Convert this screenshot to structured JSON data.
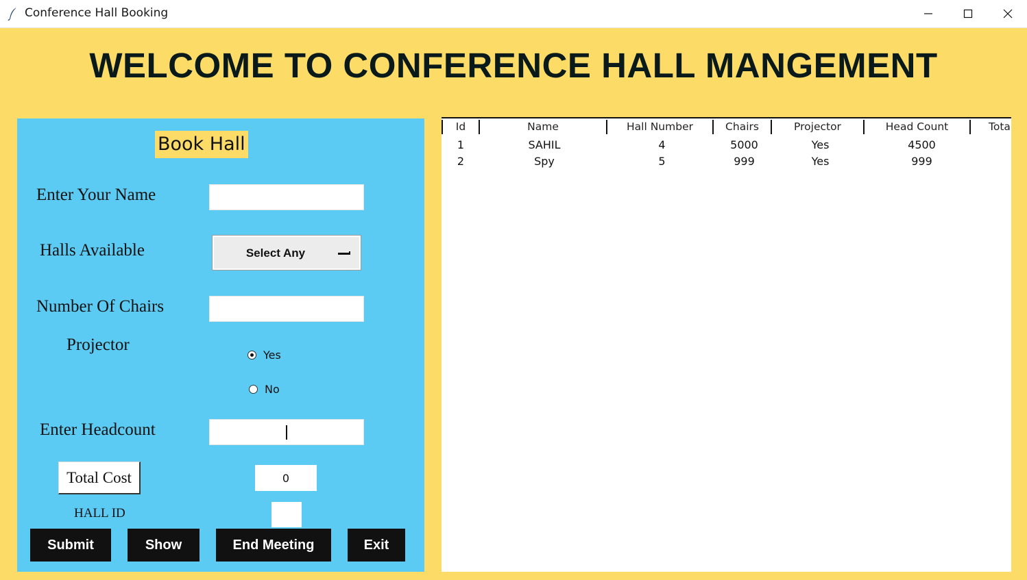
{
  "window": {
    "title": "Conference Hall Booking",
    "app_icon": "feather-icon",
    "controls": [
      "minimize-icon",
      "maximize-icon",
      "close-icon"
    ]
  },
  "heading": "WELCOME TO CONFERENCE HALL MANGEMENT",
  "form": {
    "title": "Book Hall",
    "name_label": "Enter Your Name",
    "name_value": "",
    "halls_label": "Halls Available",
    "halls_selected": "Select Any",
    "chairs_label": "Number Of Chairs",
    "chairs_value": "",
    "projector_label": "Projector",
    "projector_options": [
      {
        "label": "Yes",
        "selected": true
      },
      {
        "label": "No",
        "selected": false
      }
    ],
    "headcount_label": "Enter Headcount",
    "headcount_value": "",
    "total_cost_button": "Total Cost",
    "total_cost_value": "0",
    "hall_id_label": "HALL ID",
    "hall_id_value": ""
  },
  "buttons": {
    "submit": "Submit",
    "show": "Show",
    "end_meeting": "End Meeting",
    "exit": "Exit"
  },
  "table": {
    "columns": [
      "Id",
      "Name",
      "Hall Number",
      "Chairs",
      "Projector",
      "Head Count",
      "Tota"
    ],
    "rows": [
      [
        "1",
        "SAHIL",
        "4",
        "5000",
        "Yes",
        "4500"
      ],
      [
        "2",
        "Spy",
        "5",
        "999",
        "Yes",
        "999"
      ]
    ]
  },
  "colors": {
    "background": "#fcdc67",
    "form_panel": "#5ccbf3",
    "dark_button": "#111111"
  }
}
